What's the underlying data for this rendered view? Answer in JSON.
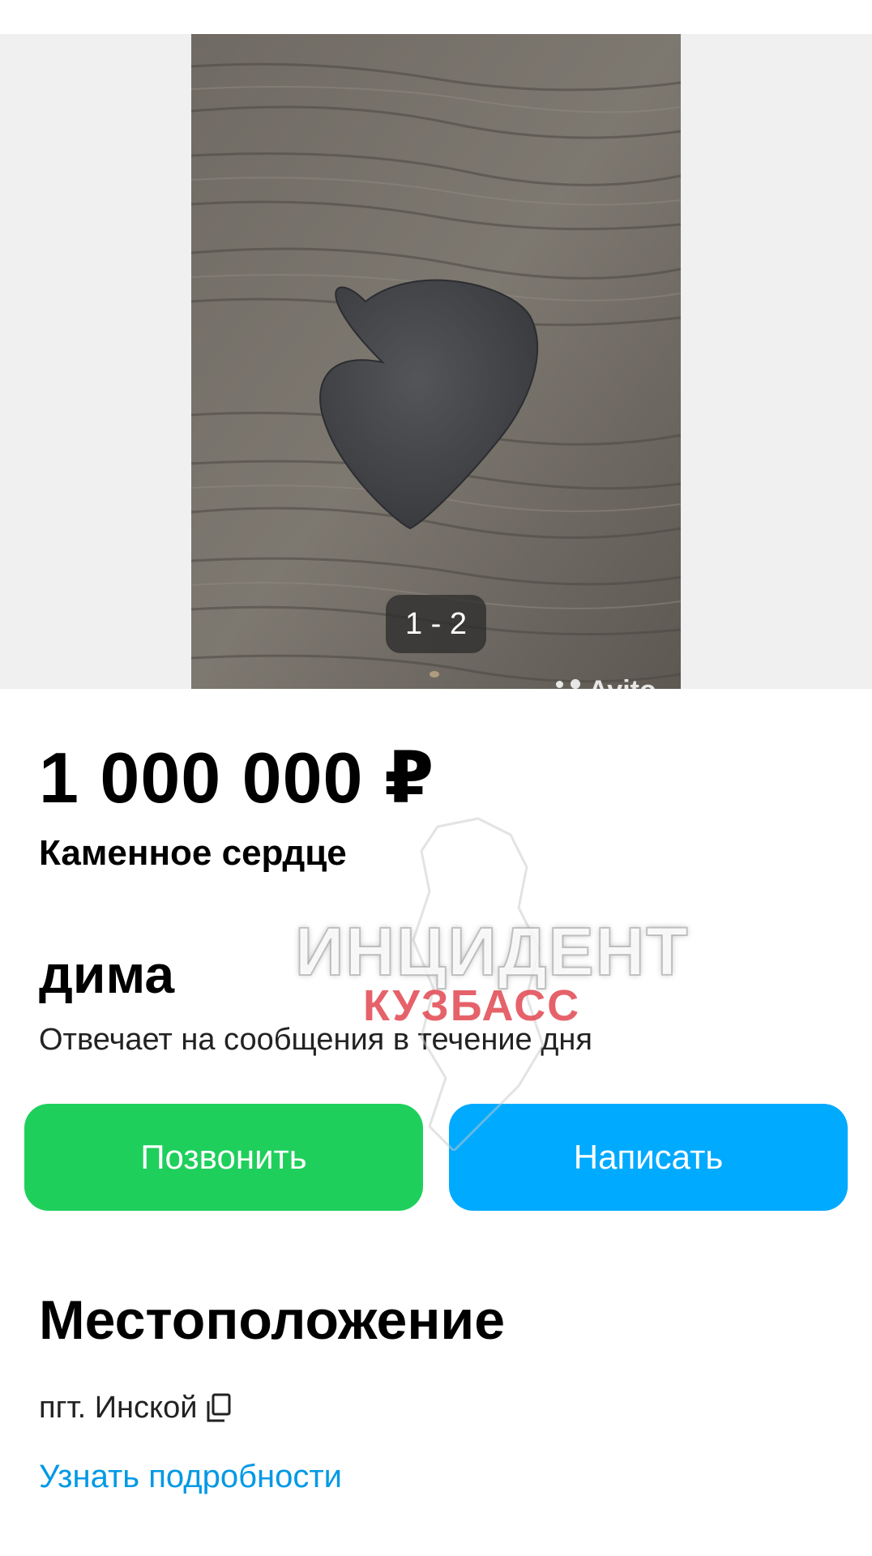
{
  "gallery": {
    "counter": "1 - 2",
    "watermark": "Avito"
  },
  "listing": {
    "price": "1 000 000 ₽",
    "title": "Каменное сердце"
  },
  "seller": {
    "name": "дима",
    "response_note": "Отвечает на сообщения в течение дня"
  },
  "actions": {
    "call_label": "Позвонить",
    "write_label": "Написать"
  },
  "location": {
    "section_title": "Местоположение",
    "address": "пгт. Инской",
    "more_link": "Узнать подробности"
  },
  "overlay_watermark": {
    "line1": "ИНЦИДЕНТ",
    "line2": "КУЗБАСС"
  },
  "colors": {
    "call_button": "#1fcf5c",
    "write_button": "#00aaff",
    "link": "#0099e5"
  },
  "icons": {
    "copy": "copy-icon",
    "avito_logo": "avito-logo-icon"
  }
}
